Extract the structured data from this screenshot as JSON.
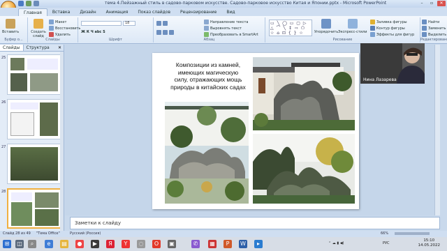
{
  "window": {
    "title": "тема 4.Пейзажный стиль в садово-парковом искусстве. Садово-парковое искусство Китая и Японии.pptx - Microsoft PowerPoint"
  },
  "ribbon": {
    "tabs": [
      "Главная",
      "Вставка",
      "Дизайн",
      "Анимация",
      "Показ слайдов",
      "Рецензирование",
      "Вид"
    ],
    "active_tab": "Главная",
    "groups": {
      "clipboard": {
        "label": "Буфер о...",
        "paste": "Вставить",
        "cut": "Вырезать",
        "copy": "Копировать"
      },
      "slides": {
        "label": "Слайды",
        "new_slide": "Создать слайд",
        "layout": "Макет",
        "reset": "Восстановить",
        "delete": "Удалить"
      },
      "font": {
        "label": "Шрифт",
        "font_size": "18"
      },
      "paragraph": {
        "label": "Абзац",
        "text_direction": "Направление текста",
        "align_text": "Выровнять текст",
        "smartart": "Преобразовать в SmartArt"
      },
      "drawing": {
        "label": "Рисование",
        "arrange": "Упорядочить",
        "quick_styles": "Экспресс-стили",
        "shape_fill": "Заливка фигуры",
        "shape_outline": "Контур фигуры",
        "shape_effects": "Эффекты для фигур"
      },
      "editing": {
        "label": "Редактирование",
        "find": "Найти",
        "replace": "Заменить",
        "select": "Выделить"
      }
    }
  },
  "left_panel": {
    "tabs": [
      "Слайды",
      "Структура"
    ],
    "active_tab": "Слайды",
    "thumbnails": [
      {
        "number": "25"
      },
      {
        "number": "26"
      },
      {
        "number": "27"
      },
      {
        "number": "28"
      }
    ]
  },
  "slide": {
    "title": "Композиции из камней, имеющих магическую силу, отражающих мощь природы в китайских садах"
  },
  "video": {
    "participant_name": "Нина Лазарева"
  },
  "notes": {
    "placeholder": "Заметки к слайду"
  },
  "status_bar": {
    "slide_counter": "Слайд 28 из 49",
    "theme": "\"Тема Office\"",
    "language": "Русский (Россия)",
    "zoom": "66%"
  },
  "taskbar": {
    "language": "РУС",
    "time": "15:10",
    "date": "14.05.2022"
  },
  "colors": {
    "ribbon": "#dce8f6",
    "accent_office_button": "#f0a030",
    "selected_thumbnail": "#f0b040"
  }
}
